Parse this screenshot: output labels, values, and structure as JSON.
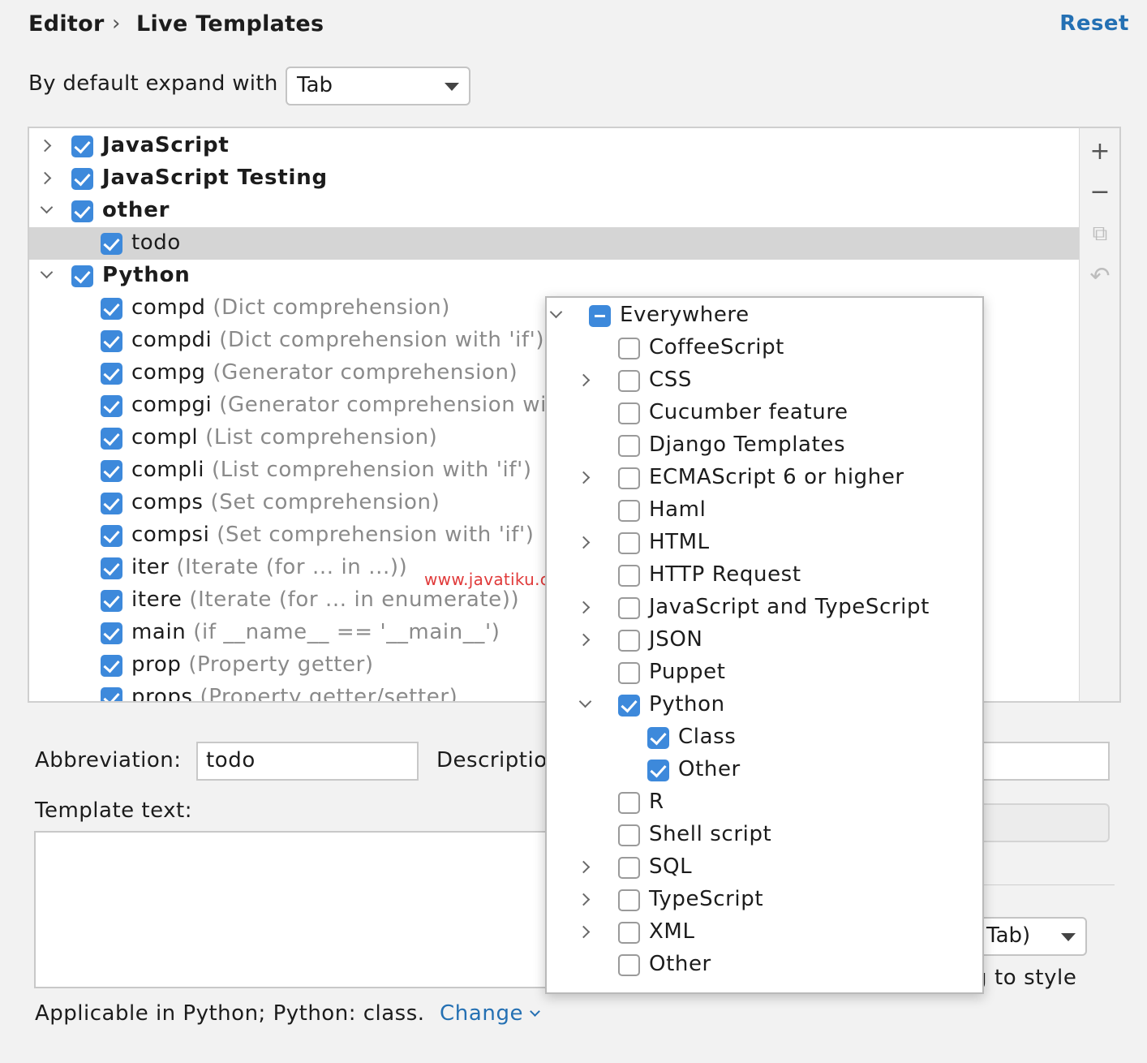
{
  "header": {
    "breadcrumb_root": "Editor",
    "breadcrumb_separator": "›",
    "breadcrumb_current": "Live Templates",
    "reset_label": "Reset"
  },
  "expand": {
    "label": "By default expand with",
    "value": "Tab"
  },
  "tree": {
    "groups": [
      {
        "label": "JavaScript",
        "expanded": false,
        "checked": true
      },
      {
        "label": "JavaScript Testing",
        "expanded": false,
        "checked": true
      },
      {
        "label": "other",
        "expanded": true,
        "checked": true
      },
      {
        "label": "todo",
        "checked": true,
        "selected": true
      },
      {
        "label": "Python",
        "expanded": true,
        "checked": true
      }
    ],
    "python_items": [
      {
        "abbr": "compd",
        "desc": "(Dict comprehension)"
      },
      {
        "abbr": "compdi",
        "desc": "(Dict comprehension with 'if')"
      },
      {
        "abbr": "compg",
        "desc": "(Generator comprehension)"
      },
      {
        "abbr": "compgi",
        "desc": "(Generator comprehension with"
      },
      {
        "abbr": "compl",
        "desc": "(List comprehension)"
      },
      {
        "abbr": "compli",
        "desc": "(List comprehension with 'if')"
      },
      {
        "abbr": "comps",
        "desc": "(Set comprehension)"
      },
      {
        "abbr": "compsi",
        "desc": "(Set comprehension with 'if')"
      },
      {
        "abbr": "iter",
        "desc": "(Iterate (for ... in ...))"
      },
      {
        "abbr": "itere",
        "desc": "(Iterate (for ... in enumerate))"
      },
      {
        "abbr": "main",
        "desc": "(if __name__ == '__main__')"
      },
      {
        "abbr": "prop",
        "desc": "(Property getter)"
      },
      {
        "abbr": "props",
        "desc": "(Property getter/setter)"
      }
    ]
  },
  "toolbar": {
    "add": "+",
    "remove": "−",
    "copy": "⧉",
    "restore": "↶"
  },
  "form": {
    "abbreviation_label": "Abbreviation:",
    "abbreviation_value": "todo",
    "description_label": "Descriptio",
    "template_text_label": "Template text:",
    "expand_with_value": "Tab)",
    "style_text": "g to style",
    "applicable_text": "Applicable in Python; Python: class.",
    "change_label": "Change"
  },
  "watermark": "www.javatiku.cn",
  "popup": {
    "items": [
      {
        "label": "Everywhere",
        "level": 0,
        "chevron": "down",
        "state": "partial"
      },
      {
        "label": "CoffeeScript",
        "level": 1,
        "chevron": "",
        "state": "off"
      },
      {
        "label": "CSS",
        "level": 1,
        "chevron": "right",
        "state": "off"
      },
      {
        "label": "Cucumber feature",
        "level": 1,
        "chevron": "",
        "state": "off"
      },
      {
        "label": "Django Templates",
        "level": 1,
        "chevron": "",
        "state": "off"
      },
      {
        "label": "ECMAScript 6 or higher",
        "level": 1,
        "chevron": "right",
        "state": "off"
      },
      {
        "label": "Haml",
        "level": 1,
        "chevron": "",
        "state": "off"
      },
      {
        "label": "HTML",
        "level": 1,
        "chevron": "right",
        "state": "off"
      },
      {
        "label": "HTTP Request",
        "level": 1,
        "chevron": "",
        "state": "off"
      },
      {
        "label": "JavaScript and TypeScript",
        "level": 1,
        "chevron": "right",
        "state": "off"
      },
      {
        "label": "JSON",
        "level": 1,
        "chevron": "right",
        "state": "off"
      },
      {
        "label": "Puppet",
        "level": 1,
        "chevron": "",
        "state": "off"
      },
      {
        "label": "Python",
        "level": 1,
        "chevron": "down",
        "state": "on"
      },
      {
        "label": "Class",
        "level": 2,
        "chevron": "",
        "state": "on"
      },
      {
        "label": "Other",
        "level": 2,
        "chevron": "",
        "state": "on"
      },
      {
        "label": "R",
        "level": 1,
        "chevron": "",
        "state": "off"
      },
      {
        "label": "Shell script",
        "level": 1,
        "chevron": "",
        "state": "off"
      },
      {
        "label": "SQL",
        "level": 1,
        "chevron": "right",
        "state": "off"
      },
      {
        "label": "TypeScript",
        "level": 1,
        "chevron": "right",
        "state": "off"
      },
      {
        "label": "XML",
        "level": 1,
        "chevron": "right",
        "state": "off"
      },
      {
        "label": "Other",
        "level": 1,
        "chevron": "",
        "state": "off"
      }
    ]
  },
  "colors": {
    "accent": "#3d89db",
    "link": "#2470b3",
    "selection": "#d5d5d5",
    "watermark": "#e03a3a"
  }
}
